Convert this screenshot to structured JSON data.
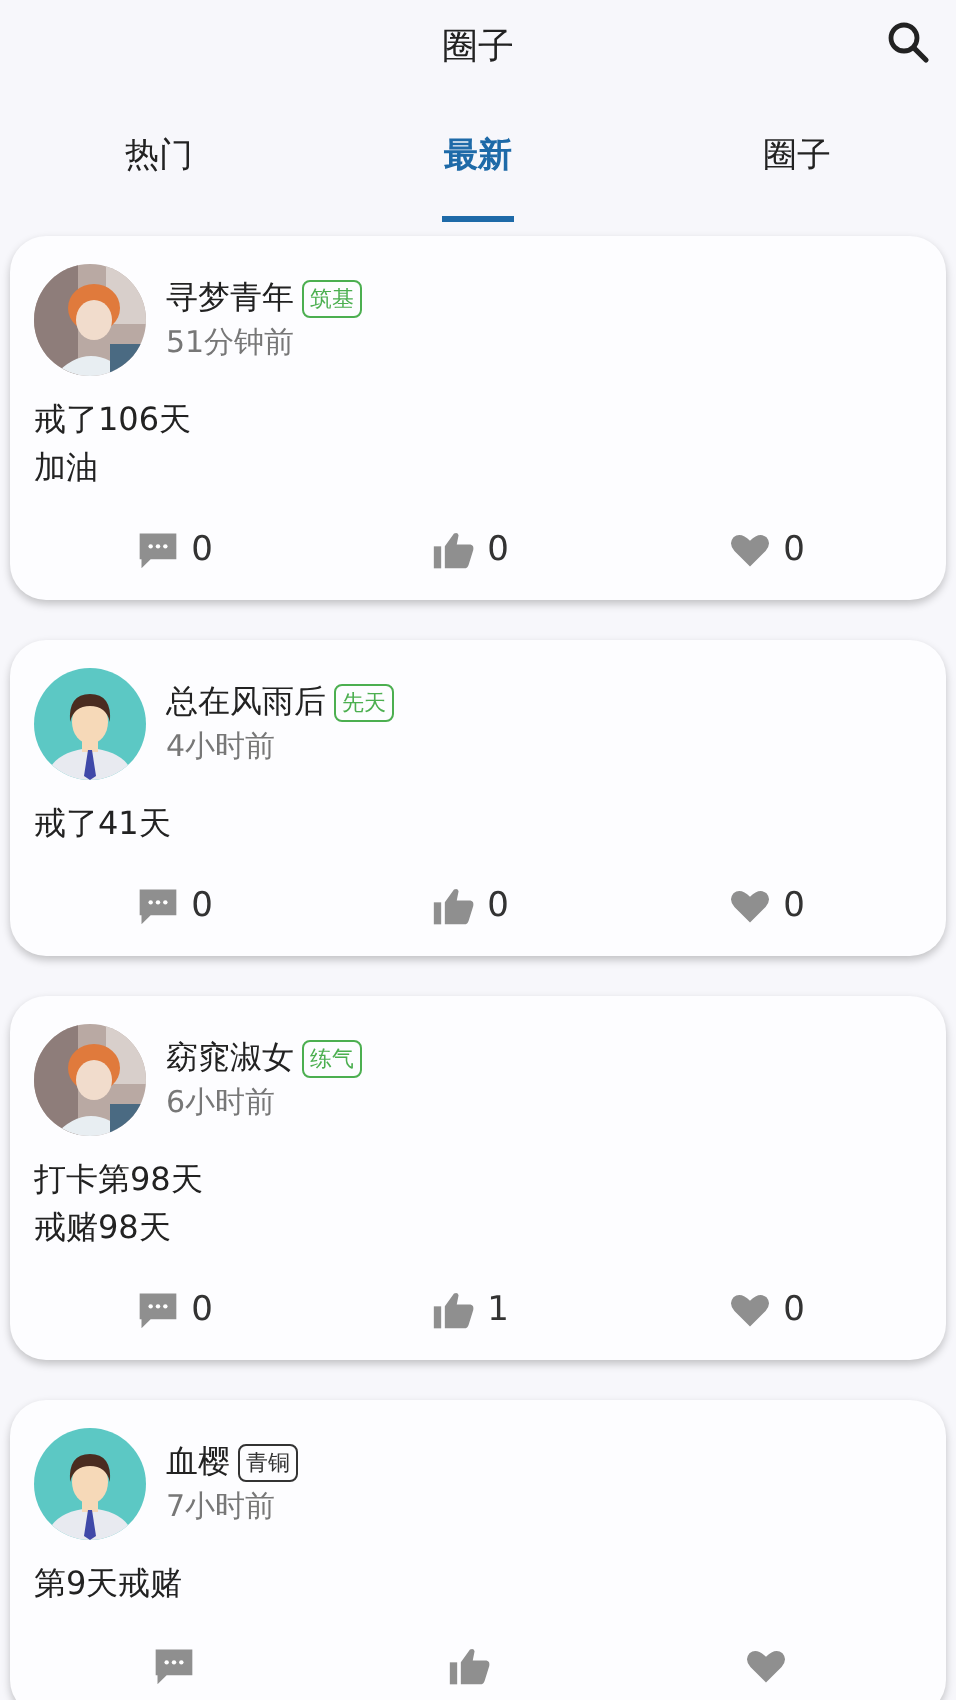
{
  "header": {
    "title": "圈子"
  },
  "tabs": [
    {
      "label": "热门",
      "selected": false
    },
    {
      "label": "最新",
      "selected": true
    },
    {
      "label": "圈子",
      "selected": false
    }
  ],
  "posts": [
    {
      "avatar": {
        "kind": "picture"
      },
      "name": "寻梦青年",
      "badge": {
        "label": "筑基",
        "color": "#4caf50"
      },
      "time": "51分钟前",
      "lines": [
        "戒了106天",
        "加油"
      ],
      "comments": "0",
      "likes": "0",
      "favorites": "0"
    },
    {
      "avatar": {
        "kind": "default"
      },
      "name": "总在风雨后",
      "badge": {
        "label": "先天",
        "color": "#4caf50"
      },
      "time": "4小时前",
      "lines": [
        "戒了41天"
      ],
      "comments": "0",
      "likes": "0",
      "favorites": "0"
    },
    {
      "avatar": {
        "kind": "picture"
      },
      "name": "窈窕淑女",
      "badge": {
        "label": "练气",
        "color": "#4caf50"
      },
      "time": "6小时前",
      "lines": [
        "打卡第98天",
        "戒赌98天"
      ],
      "comments": "0",
      "likes": "1",
      "favorites": "0"
    },
    {
      "avatar": {
        "kind": "default"
      },
      "name": "血樱",
      "badge": {
        "label": "青铜",
        "color": "#333333"
      },
      "time": "7小时前",
      "lines": [
        "第9天戒赌"
      ]
    }
  ]
}
